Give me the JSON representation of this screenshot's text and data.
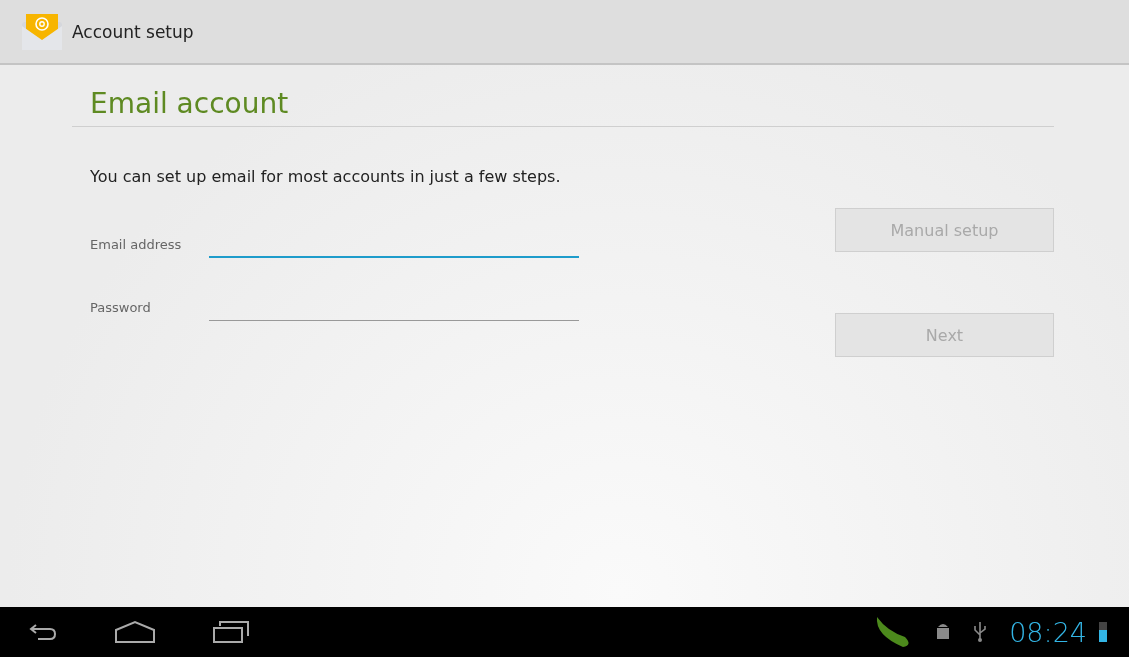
{
  "action_bar": {
    "title": "Account setup"
  },
  "heading": "Email account",
  "intro": "You can set up email for most accounts in just a few steps.",
  "fields": [
    {
      "label": "Email address",
      "selected": true
    },
    {
      "label": "Password",
      "selected": false
    }
  ],
  "buttons": [
    {
      "label": "Manual setup",
      "disabled": true
    },
    {
      "label": "Next",
      "disabled": true
    }
  ],
  "status_bar": {
    "time": "08:24",
    "battery": {
      "level": 0.6
    }
  }
}
